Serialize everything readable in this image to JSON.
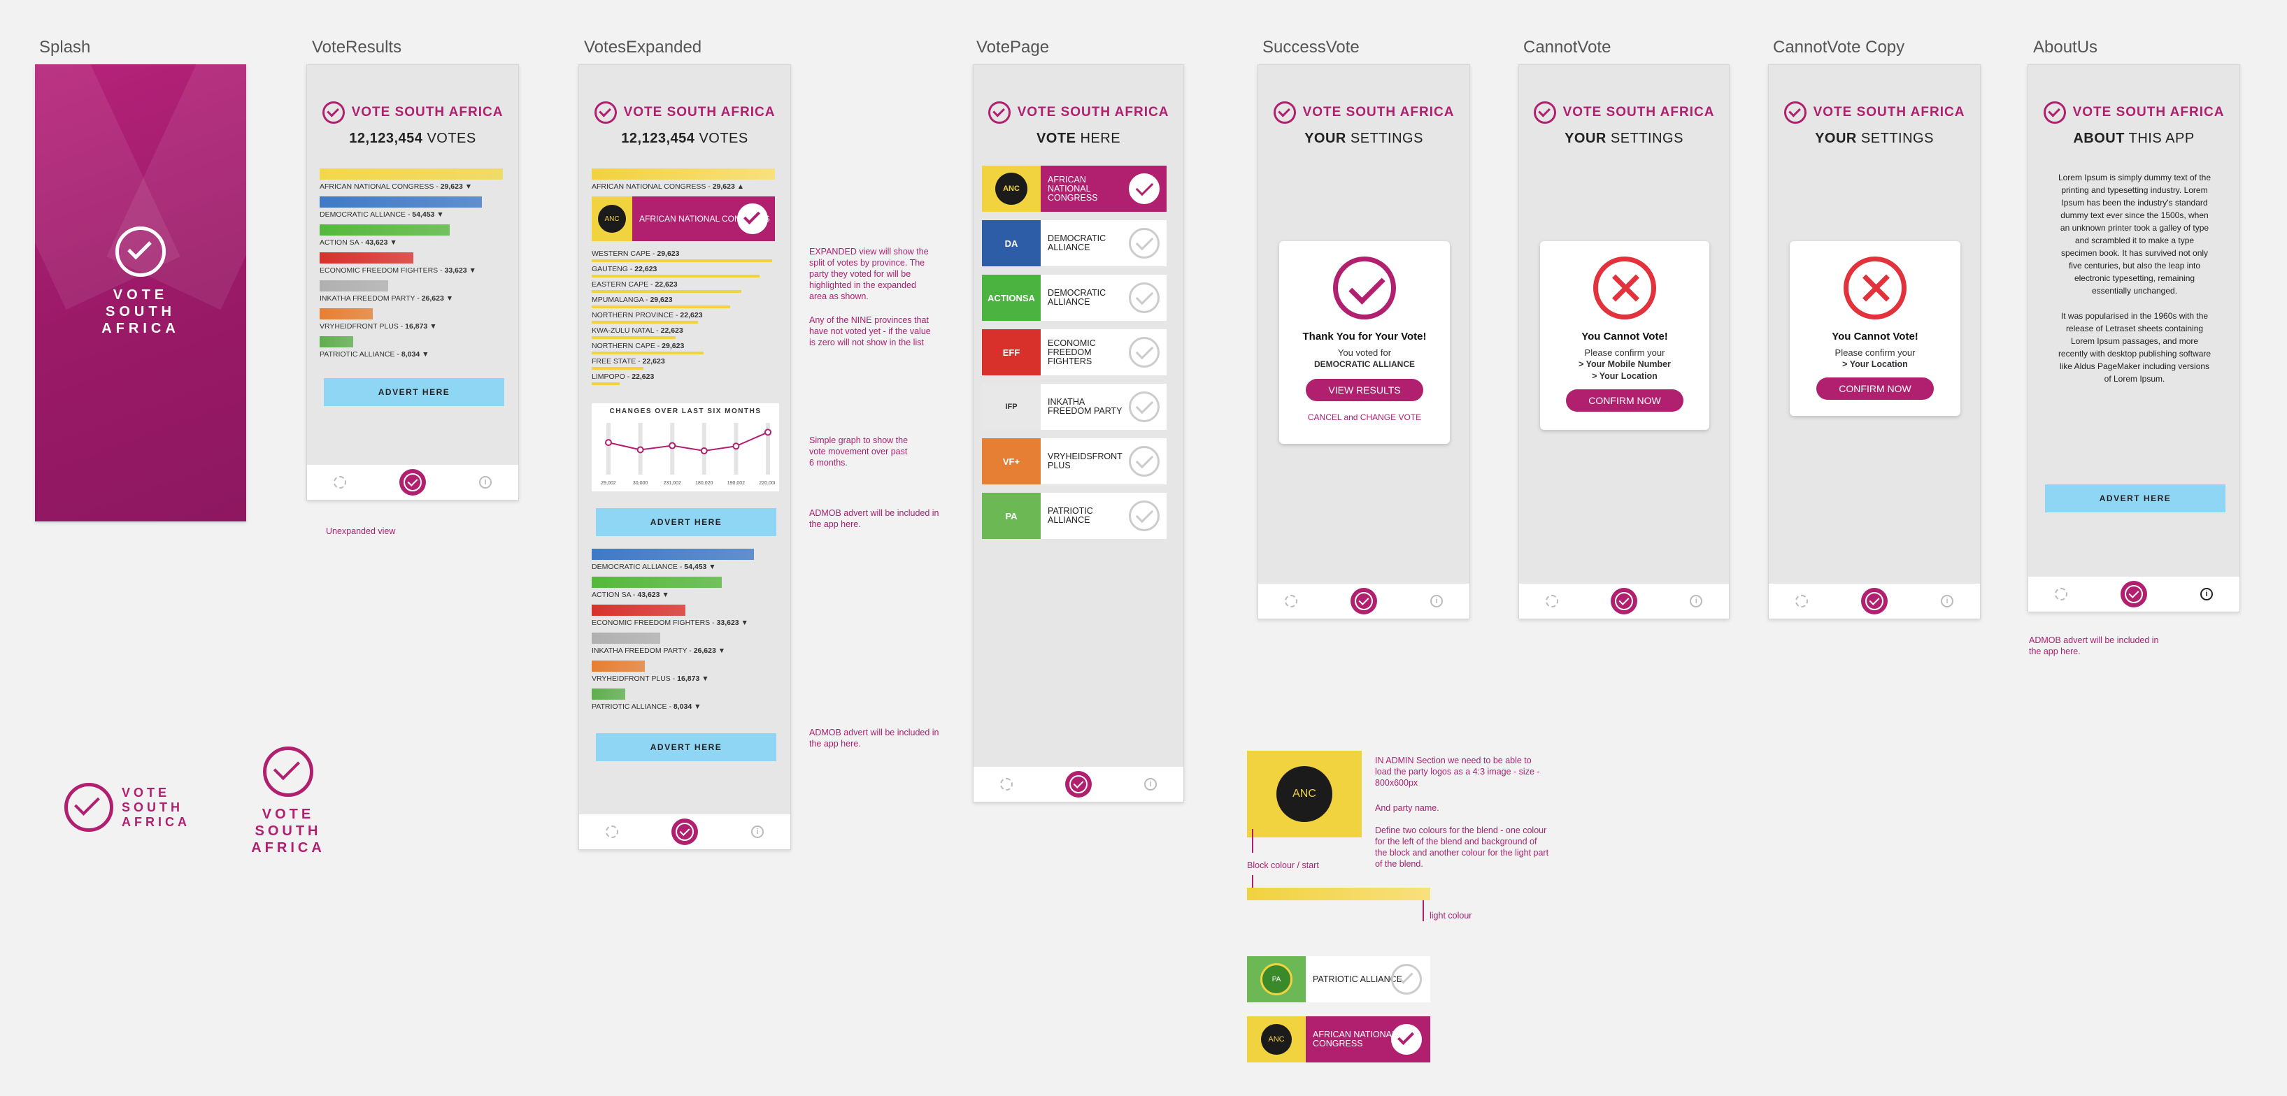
{
  "frames": {
    "splash": "Splash",
    "vote_results": "VoteResults",
    "votes_expanded": "VotesExpanded",
    "vote_page": "VotePage",
    "success_vote": "SuccessVote",
    "cannot_vote": "CannotVote",
    "cannot_vote_copy": "CannotVote Copy",
    "about_us": "AboutUs"
  },
  "brand": {
    "name": "VOTE SOUTH AFRICA",
    "line1": "VOTE",
    "line2": "SOUTH",
    "line3": "AFRICA",
    "accent": "#b0206f"
  },
  "results": {
    "total_count": "12,123,454",
    "total_label": "VOTES",
    "parties": [
      {
        "name": "AFRICAN NATIONAL CONGRESS",
        "votes": "29,623",
        "color": "#f3d74a"
      },
      {
        "name": "DEMOCRATIC ALLIANCE",
        "votes": "54,453",
        "color": "#3f7ac6"
      },
      {
        "name": "ACTION SA",
        "votes": "43,623",
        "color": "#55b83c"
      },
      {
        "name": "ECONOMIC FREEDOM FIGHTERS",
        "votes": "33,623",
        "color": "#d8312c"
      },
      {
        "name": "INKATHA FREEDOM PARTY",
        "votes": "26,623",
        "color": "#b0b0b0"
      },
      {
        "name": "VRYHEIDFRONT PLUS",
        "votes": "16,873",
        "color": "#e67f33"
      },
      {
        "name": "PATRIOTIC ALLIANCE",
        "votes": "8,034",
        "color": "#5fae4e"
      }
    ],
    "advert": "ADVERT HERE",
    "unexpanded_note": "Unexpanded view"
  },
  "expanded": {
    "selected_party": "AFRICAN NATIONAL CONGRESS",
    "selected_party_block": "AFRICAN NATIONAL CONGRESS",
    "provinces": [
      {
        "name": "WESTERN CAPE",
        "votes": "29,623"
      },
      {
        "name": "GAUTENG",
        "votes": "22,623"
      },
      {
        "name": "EASTERN CAPE",
        "votes": "22,623"
      },
      {
        "name": "MPUMALANGA",
        "votes": "29,623"
      },
      {
        "name": "NORTHERN PROVINCE",
        "votes": "22,623"
      },
      {
        "name": "KWA-ZULU NATAL",
        "votes": "22,623"
      },
      {
        "name": "NORTHERN CAPE",
        "votes": "29,623"
      },
      {
        "name": "FREE STATE",
        "votes": "22,623"
      },
      {
        "name": "LIMPOPO",
        "votes": "22,623"
      }
    ],
    "graph_title": "CHANGES OVER LAST SIX MONTHS",
    "graph_ticks": [
      "29,002",
      "30,000",
      "231,002",
      "180,020",
      "190,002",
      "220,000"
    ],
    "notes": {
      "expanded": "EXPANDED view will show the split of votes by province. The party they voted for will be highlighted in the expanded area as shown.",
      "nine": "Any of the NINE provinces that have not voted yet - if the value is zero will not show in the list",
      "graph": "Simple graph to show the vote movement over past 6 months.",
      "admob1": "ADMOB advert will be included in the app here.",
      "admob2": "ADMOB advert will be included in the app here."
    }
  },
  "chart_data": {
    "type": "line",
    "title": "CHANGES OVER LAST SIX MONTHS",
    "categories": [
      "29,002",
      "30,000",
      "231,002",
      "180,020",
      "190,002",
      "220,000"
    ],
    "values": [
      62,
      48,
      56,
      46,
      55,
      82
    ],
    "color": "#b0206f"
  },
  "vote_page": {
    "subtitle_bold": "VOTE",
    "subtitle_rest": "HERE",
    "parties": [
      {
        "name": "AFRICAN NATIONAL CONGRESS",
        "logo": "ANC",
        "selected": true
      },
      {
        "name": "DEMOCRATIC ALLIANCE",
        "logo": "DA"
      },
      {
        "name": "DEMOCRATIC ALLIANCE",
        "logo": "ACTIONSA"
      },
      {
        "name": "ECONOMIC FREEDOM FIGHTERS",
        "logo": "EFF"
      },
      {
        "name": "INKATHA FREEDOM PARTY",
        "logo": "IFP"
      },
      {
        "name": "VRYHEIDSFRONT PLUS",
        "logo": "VF+"
      },
      {
        "name": "PATRIOTIC ALLIANCE",
        "logo": "PA"
      }
    ]
  },
  "success": {
    "subtitle_bold": "YOUR",
    "subtitle_rest": "SETTINGS",
    "heading": "Thank You for Your Vote!",
    "voted_for": "You voted for",
    "party": "DEMOCRATIC ALLIANCE",
    "view_results": "VIEW RESULTS",
    "cancel": "CANCEL and CHANGE VOTE"
  },
  "cannot": {
    "subtitle_bold": "YOUR",
    "subtitle_rest": "SETTINGS",
    "heading": "You Cannot Vote!",
    "confirm": "Please confirm your",
    "item_mobile": "> Your Mobile Number",
    "item_location": "> Your Location",
    "button": "CONFIRM NOW"
  },
  "about": {
    "subtitle_bold": "ABOUT",
    "subtitle_rest": "THIS APP",
    "p1": "Lorem Ipsum is simply dummy text of the printing and typesetting industry. Lorem Ipsum has been the industry's standard dummy text ever since the 1500s, when an unknown printer took a galley of type and scrambled it to make a type specimen book. It has survived not only five centuries, but also the leap into electronic typesetting, remaining essentially unchanged.",
    "p2": "It was popularised in the 1960s with the release of Letraset sheets containing Lorem Ipsum passages, and more recently with desktop publishing software like Aldus PageMaker including versions of Lorem Ipsum.",
    "advert": "ADVERT HERE",
    "note": "ADMOB advert will be included in the app here."
  },
  "admin": {
    "note1": "IN ADMIN Section we need to be able to load the party logos as a 4:3 image - size - 800x600px",
    "note2": "And party name.",
    "note3": "Define two colours for the blend - one colour for the left of the blend and background of the block and another colour for the light part of the blend.",
    "block_label": "Block colour / start",
    "light_label": "light colour",
    "sample1": "PATRIOTIC ALLIANCE",
    "sample2": "AFRICAN NATIONAL CONGRESS"
  },
  "nav": {
    "info": "i"
  }
}
